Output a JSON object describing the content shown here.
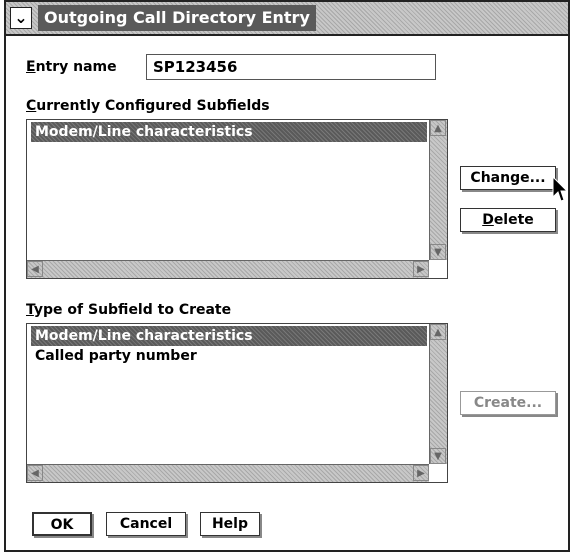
{
  "window": {
    "title": "Outgoing Call Directory Entry",
    "sysmenu_glyph": "⌄"
  },
  "entry": {
    "label_prefix": "E",
    "label_rest": "ntry name",
    "value": "SP123456"
  },
  "configured": {
    "label_prefix": "C",
    "label_rest": "urrently Configured Subfields",
    "items": [
      "Modem/Line characteristics"
    ],
    "selected_index": 0
  },
  "subfield_type": {
    "label_prefix": "T",
    "label_rest": "ype of Subfield to Create",
    "items": [
      "Modem/Line characteristics",
      "Called party number"
    ],
    "selected_index": 0
  },
  "buttons": {
    "change": "Change...",
    "delete_prefix": "D",
    "delete_rest": "elete",
    "create": "Create...",
    "ok": "OK",
    "cancel": "Cancel",
    "help": "Help"
  },
  "icons": {
    "scroll_up": "▲",
    "scroll_down": "▼",
    "scroll_left": "◀",
    "scroll_right": "▶"
  }
}
